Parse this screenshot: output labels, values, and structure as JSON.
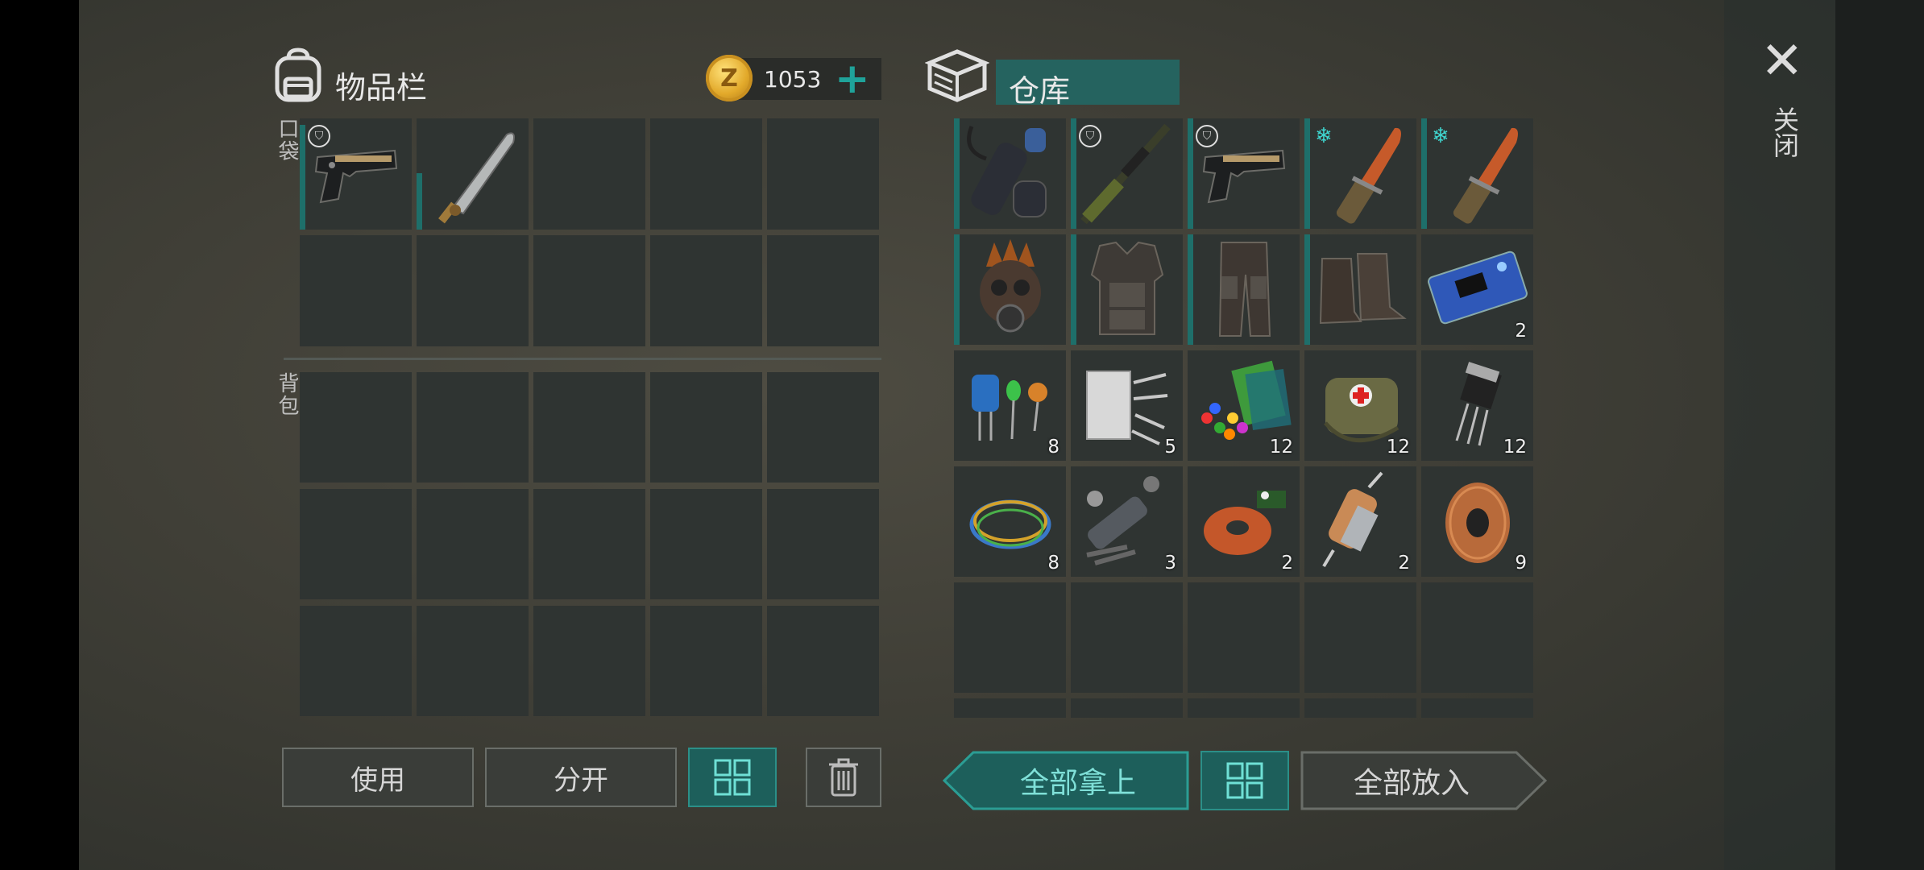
{
  "inventory": {
    "title": "物品栏",
    "icon": "backpack-icon",
    "currency": {
      "icon": "z-coin-icon",
      "coin_letter": "Z",
      "amount": "1053",
      "add_label": "+"
    },
    "pocket_label": "口袋",
    "backpack_label": "背包",
    "pocket_items": [
      {
        "item": "pistol",
        "badge": "shield",
        "count": ""
      },
      {
        "item": "machete",
        "badge": "",
        "count": ""
      }
    ]
  },
  "storage": {
    "title": "仓库",
    "icon": "storage-crate-icon",
    "items": [
      {
        "item": "scope-holster",
        "badge": "",
        "count": ""
      },
      {
        "item": "sniper-rifle",
        "badge": "shield",
        "count": ""
      },
      {
        "item": "pistol",
        "badge": "shield",
        "count": ""
      },
      {
        "item": "cold-knife",
        "badge": "snowflake",
        "count": ""
      },
      {
        "item": "cold-knife",
        "badge": "snowflake",
        "count": ""
      },
      {
        "item": "spiked-gas-mask",
        "badge": "",
        "count": ""
      },
      {
        "item": "armored-vest",
        "badge": "",
        "count": ""
      },
      {
        "item": "armored-pants",
        "badge": "",
        "count": ""
      },
      {
        "item": "armored-boots",
        "badge": "",
        "count": ""
      },
      {
        "item": "circuit-board",
        "badge": "",
        "count": "2"
      },
      {
        "item": "capacitors-leds",
        "badge": "",
        "count": "8"
      },
      {
        "item": "fiberglass",
        "badge": "",
        "count": "5"
      },
      {
        "item": "plastic-granules",
        "badge": "",
        "count": "12"
      },
      {
        "item": "first-aid-bag",
        "badge": "",
        "count": "12"
      },
      {
        "item": "transistor",
        "badge": "",
        "count": "12"
      },
      {
        "item": "wires",
        "badge": "",
        "count": "8"
      },
      {
        "item": "hand-drill-kit",
        "badge": "",
        "count": "3"
      },
      {
        "item": "copper-coil",
        "badge": "",
        "count": "2"
      },
      {
        "item": "electric-motor",
        "badge": "",
        "count": "2"
      },
      {
        "item": "copper-spool",
        "badge": "",
        "count": "9"
      }
    ]
  },
  "buttons": {
    "use": "使用",
    "split": "分开",
    "sort_icon": "grid-sort-icon",
    "delete_icon": "trash-icon",
    "take_all": "全部拿上",
    "put_all": "全部放入"
  },
  "close": {
    "icon": "close-icon",
    "label": "关闭"
  },
  "colors": {
    "accent": "#1fa39a",
    "accent_dark": "#1d5f5b",
    "slot": "#2f3432",
    "durability": "#1e6f6a"
  }
}
